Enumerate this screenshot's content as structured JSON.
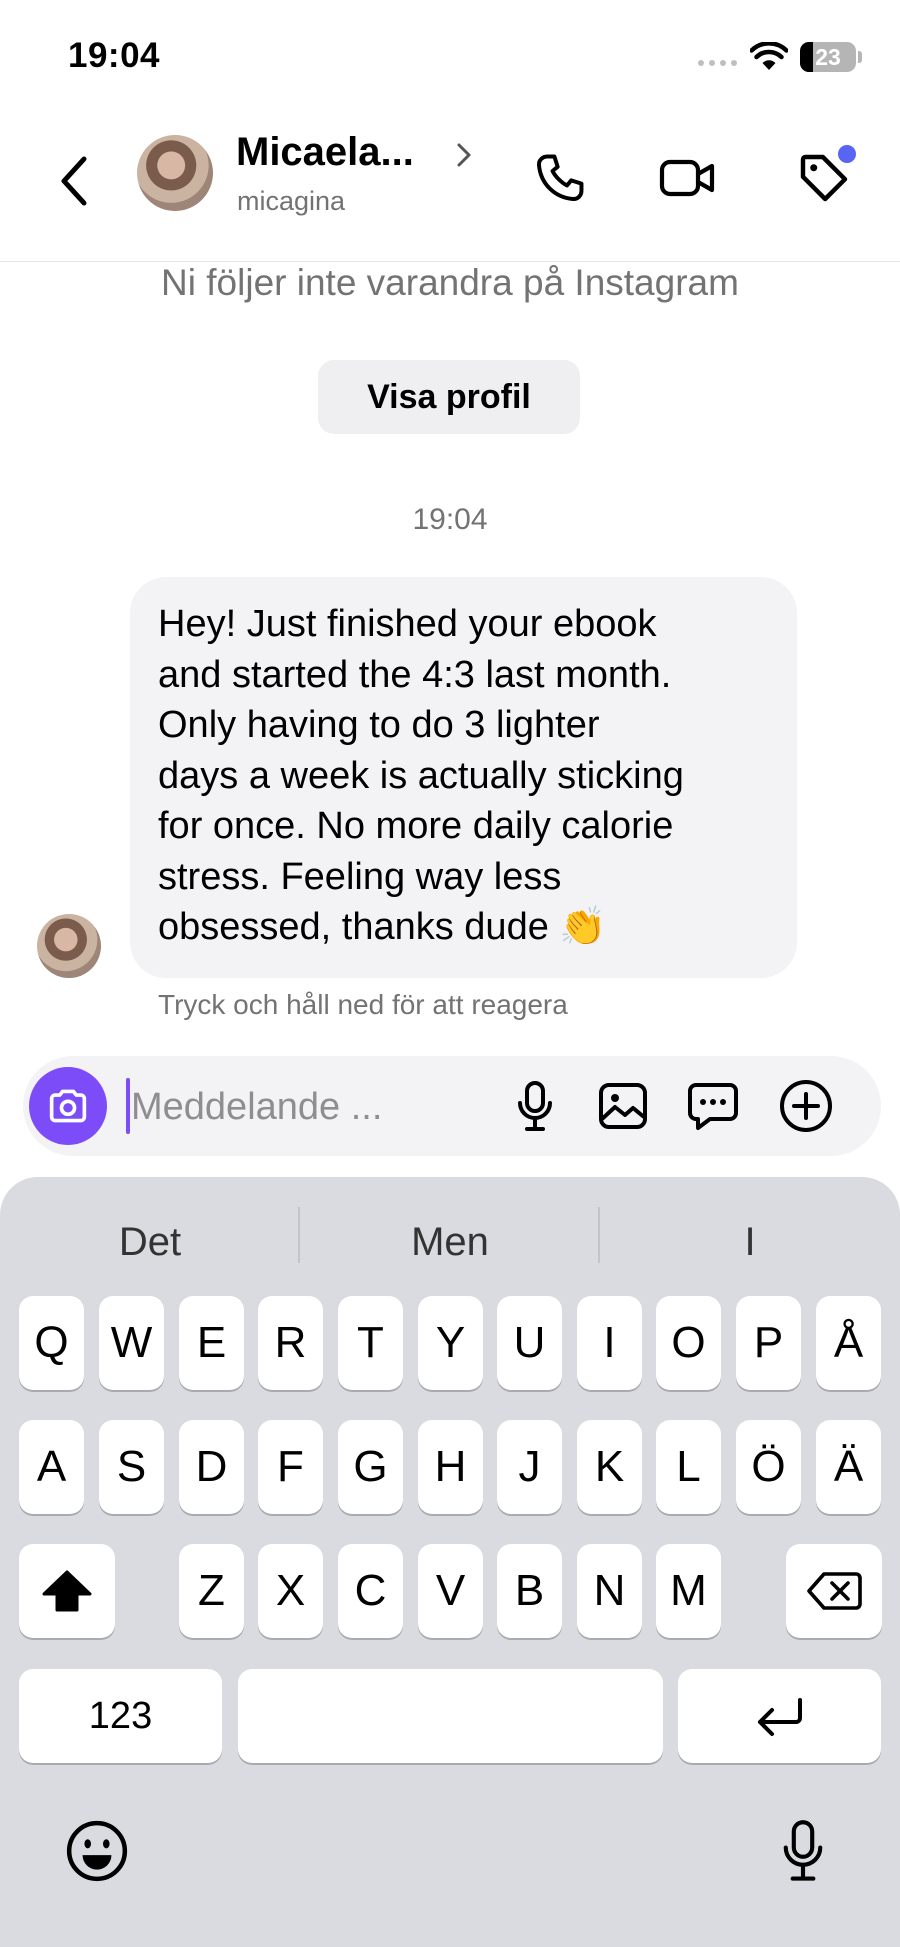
{
  "status_bar": {
    "time": "19:04",
    "battery_level": "23"
  },
  "header": {
    "contact_name": "Micaela...",
    "username": "micagina"
  },
  "conversation": {
    "follow_notice": "Ni följer inte varandra på Instagram",
    "view_profile_label": "Visa profil",
    "timestamp": "19:04",
    "message_lines": [
      "Hey! Just finished your ebook",
      "and started the 4:3 last month.",
      "Only having to do 3 lighter",
      "days a week is actually sticking",
      "for once. No more daily calorie",
      "stress. Feeling way less",
      "obsessed, thanks dude 👏"
    ],
    "react_hint": "Tryck och håll ned för att reagera"
  },
  "composer": {
    "placeholder": "Meddelande ..."
  },
  "keyboard": {
    "suggestions": [
      "Det",
      "Men",
      "I"
    ],
    "row1": [
      "Q",
      "W",
      "E",
      "R",
      "T",
      "Y",
      "U",
      "I",
      "O",
      "P",
      "Å"
    ],
    "row2": [
      "A",
      "S",
      "D",
      "F",
      "G",
      "H",
      "J",
      "K",
      "L",
      "Ö",
      "Ä"
    ],
    "row3": [
      "Z",
      "X",
      "C",
      "V",
      "B",
      "N",
      "M"
    ],
    "numbers_label": "123",
    "space_label": ""
  },
  "colors": {
    "accent": "#7b4cf7",
    "notification_dot": "#5865f2",
    "bubble": "#f3f3f6",
    "keyboard_bg": "#d9dbe0"
  }
}
